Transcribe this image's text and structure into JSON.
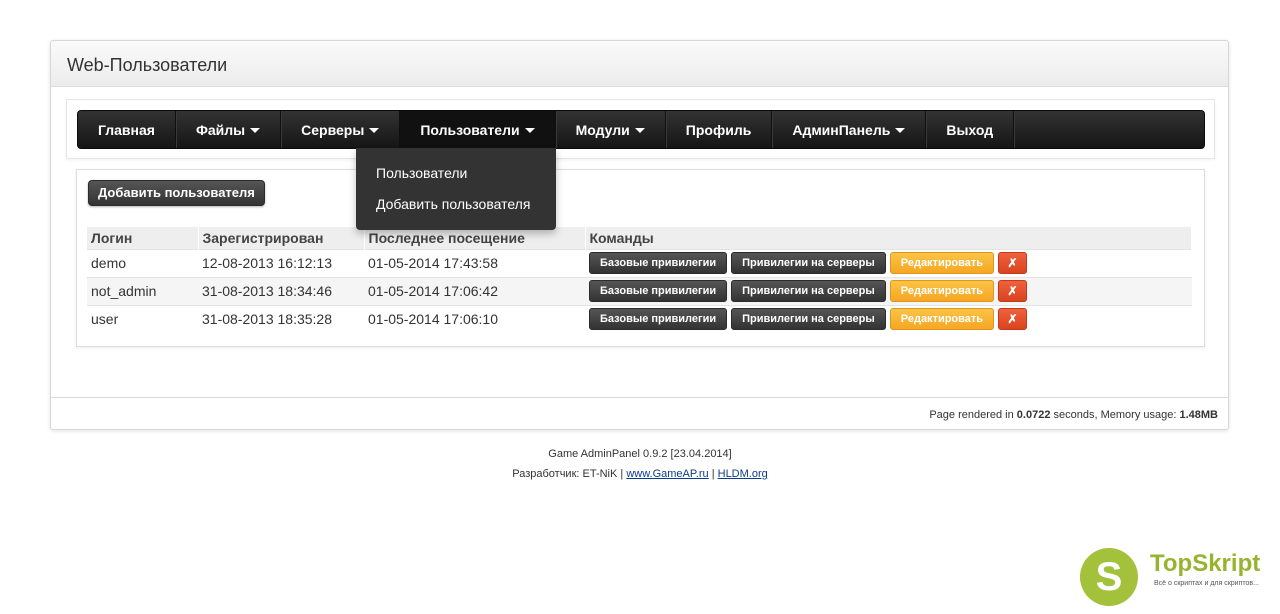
{
  "panel": {
    "title": "Web-Пользователи"
  },
  "nav": {
    "items": [
      {
        "label": "Главная",
        "caret": false
      },
      {
        "label": "Файлы",
        "caret": true
      },
      {
        "label": "Серверы",
        "caret": true
      },
      {
        "label": "Пользователи",
        "caret": true,
        "active": true
      },
      {
        "label": "Модули",
        "caret": true
      },
      {
        "label": "Профиль",
        "caret": false
      },
      {
        "label": "АдминПанель",
        "caret": true
      },
      {
        "label": "Выход",
        "caret": false
      }
    ],
    "dropdown": [
      "Пользователи",
      "Добавить пользователя"
    ]
  },
  "content": {
    "add_button": "Добавить пользователя",
    "headers": [
      "Логин",
      "Зарегистрирован",
      "Последнее посещение",
      "Команды"
    ],
    "rows": [
      {
        "login": "demo",
        "registered": "12-08-2013 16:12:13",
        "last_visit": "01-05-2014 17:43:58"
      },
      {
        "login": "not_admin",
        "registered": "31-08-2013 18:34:46",
        "last_visit": "01-05-2014 17:06:42"
      },
      {
        "login": "user",
        "registered": "31-08-2013 18:35:28",
        "last_visit": "01-05-2014 17:06:10"
      }
    ],
    "commands": {
      "base_privileges": "Базовые привилегии",
      "server_privileges": "Привилегии на серверы",
      "edit": "Редактировать",
      "delete": "✗"
    }
  },
  "panel_footer": {
    "prefix": "Page rendered in ",
    "time": "0.0722",
    "middle": " seconds, Memory usage: ",
    "memory": "1.48MB"
  },
  "footer": {
    "version": "Game AdminPanel 0.9.2 [23.04.2014]",
    "dev_prefix": "Разработчик: ET-NiK | ",
    "link1": "www.GameAP.ru",
    "sep": " | ",
    "link2": "HLDM.org"
  },
  "brand": {
    "letter": "S",
    "name": "TopSkript",
    "tagline": "Всё о скриптах и для скриптов..."
  },
  "colors": {
    "navbar": "#1e1e1e",
    "edit": "#f5a623",
    "delete": "#d9441f",
    "brand": "#a3c13a"
  }
}
